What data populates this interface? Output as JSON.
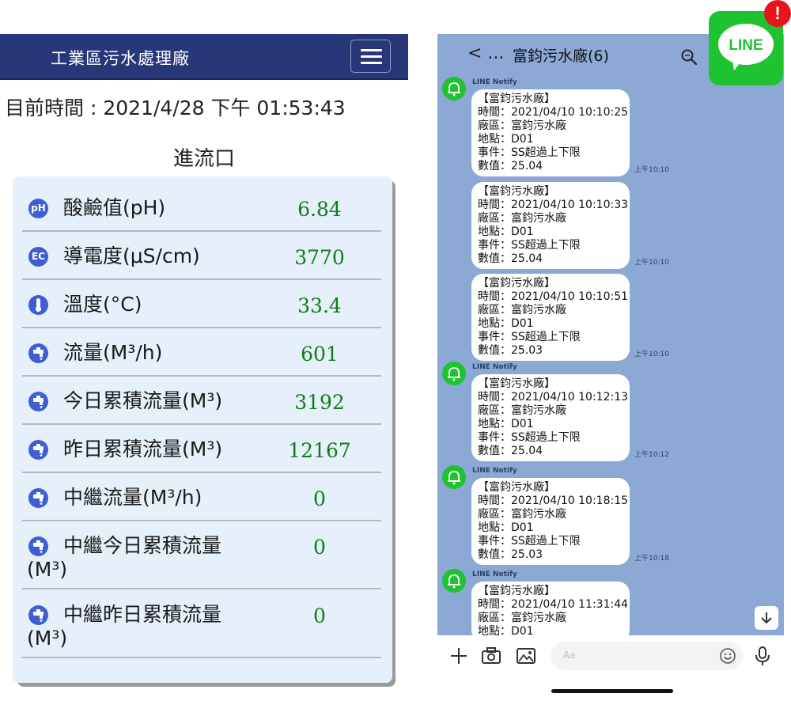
{
  "dashboard": {
    "app_title": "工業區污水處理廠",
    "current_time": "目前時間 : 2021/4/28 下午 01:53:43",
    "section_title": "進流口",
    "readings": [
      {
        "icon": "ph-icon",
        "icon_text": "pH",
        "label": "酸鹼值(pH)",
        "value": "6.84"
      },
      {
        "icon": "ec-icon",
        "icon_text": "EC",
        "label": "導電度(μS/cm)",
        "value": "3770"
      },
      {
        "icon": "thermometer-icon",
        "icon_text": "",
        "label": "溫度(°C)",
        "value": "33.4"
      },
      {
        "icon": "faucet-icon",
        "icon_text": "",
        "label": "流量(M³/h)",
        "value": "601"
      },
      {
        "icon": "faucet-icon",
        "icon_text": "",
        "label": "今日累積流量(M³)",
        "value": "3192"
      },
      {
        "icon": "faucet-icon",
        "icon_text": "",
        "label": "昨日累積流量(M³)",
        "value": "12167"
      },
      {
        "icon": "faucet-icon",
        "icon_text": "",
        "label": "中繼流量(M³/h)",
        "value": "0"
      },
      {
        "icon": "faucet-icon",
        "icon_text": "",
        "label": "中繼今日累積流量",
        "label_line2": "(M³)",
        "value": "0"
      },
      {
        "icon": "faucet-icon",
        "icon_text": "",
        "label": "中繼昨日累積流量",
        "label_line2": "(M³)",
        "value": "0"
      }
    ],
    "colors": {
      "header": "#283779",
      "value": "#0f7d16",
      "icon": "#3e5ed5",
      "card": "#e6f0fa"
    }
  },
  "chat": {
    "back_label": "< ...",
    "room_name": "富鈞污水廠(6)",
    "sender_name": "LINE Notify",
    "messages": [
      {
        "show_sender": true,
        "lines": [
          "【富鈞污水廠】",
          "時間：2021/04/10 10:10:25",
          "廠區：富鈞污水廠",
          "地點：D01",
          "事件：SS超過上下限",
          "數值：25.04"
        ],
        "time": "上午10:10"
      },
      {
        "show_sender": false,
        "lines": [
          "【富鈞污水廠】",
          "時間：2021/04/10 10:10:33",
          "廠區：富鈞污水廠",
          "地點：D01",
          "事件：SS超過上下限",
          "數值：25.04"
        ],
        "time": "上午10:10"
      },
      {
        "show_sender": false,
        "lines": [
          "【富鈞污水廠】",
          "時間：2021/04/10 10:10:51",
          "廠區：富鈞污水廠",
          "地點：D01",
          "事件：SS超過上下限",
          "數值：25.03"
        ],
        "time": "上午10:10"
      },
      {
        "show_sender": true,
        "lines": [
          "【富鈞污水廠】",
          "時間：2021/04/10 10:12:13",
          "廠區：富鈞污水廠",
          "地點：D01",
          "事件：SS超過上下限",
          "數值：25.04"
        ],
        "time": "上午10:12"
      },
      {
        "show_sender": true,
        "lines": [
          "【富鈞污水廠】",
          "時間：2021/04/10 10:18:15",
          "廠區：富鈞污水廠",
          "地點：D01",
          "事件：SS超過上下限",
          "數值：25.03"
        ],
        "time": "上午10:18"
      },
      {
        "show_sender": true,
        "lines": [
          "【富鈞污水廠】",
          "時間：2021/04/10 11:31:44",
          "廠區：富鈞污水廠",
          "地點：D01"
        ],
        "time": ""
      }
    ],
    "composer_placeholder": "Aa",
    "colors": {
      "background": "#8ca9d6",
      "avatar": "#1fc230"
    }
  },
  "line_badge": {
    "text": "LINE",
    "alert": "!",
    "color": "#1fc230",
    "alert_color": "#e8141c"
  }
}
